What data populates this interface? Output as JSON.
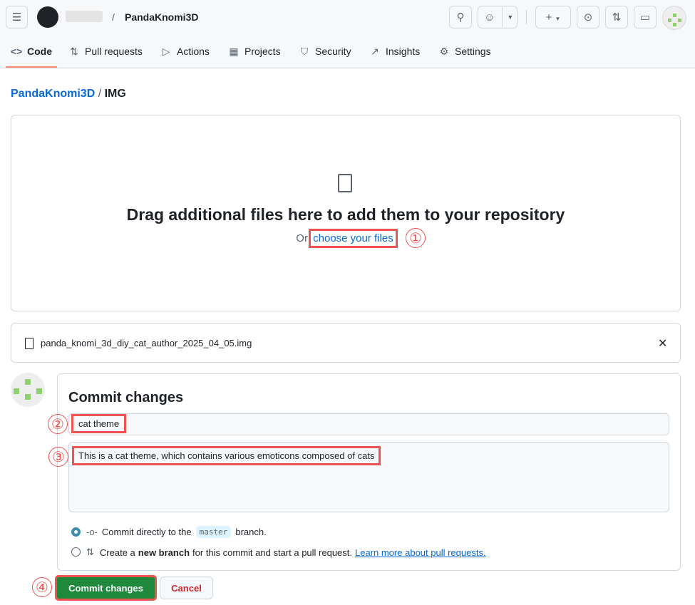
{
  "header": {
    "owner": "",
    "repo": "PandaKnomi3D"
  },
  "nav": [
    {
      "label": "Code",
      "icon": "code-icon"
    },
    {
      "label": "Pull requests",
      "icon": "git-pull-request-icon"
    },
    {
      "label": "Actions",
      "icon": "play-icon"
    },
    {
      "label": "Projects",
      "icon": "table-icon"
    },
    {
      "label": "Security",
      "icon": "shield-icon"
    },
    {
      "label": "Insights",
      "icon": "graph-icon"
    },
    {
      "label": "Settings",
      "icon": "gear-icon"
    }
  ],
  "breadcrumb": {
    "repo": "PandaKnomi3D",
    "sep": "/",
    "folder": "IMG"
  },
  "dropzone": {
    "title": "Drag additional files here to add them to your repository",
    "or": "Or",
    "link": "choose your files"
  },
  "file": {
    "name": "panda_knomi_3d_diy_cat_author_2025_04_05.img"
  },
  "commit": {
    "title": "Commit changes",
    "summary": "cat theme",
    "description": "This is a cat theme, which contains various emoticons composed of cats",
    "opt1_pre": "Commit directly to the",
    "branch": "master",
    "opt1_post": "branch.",
    "opt2_pre": "Create a",
    "opt2_bold": "new branch",
    "opt2_post": "for this commit and start a pull request.",
    "learn_more": "Learn more about pull requests.",
    "submit": "Commit changes",
    "cancel": "Cancel"
  },
  "annotations": [
    "①",
    "②",
    "③",
    "④"
  ]
}
